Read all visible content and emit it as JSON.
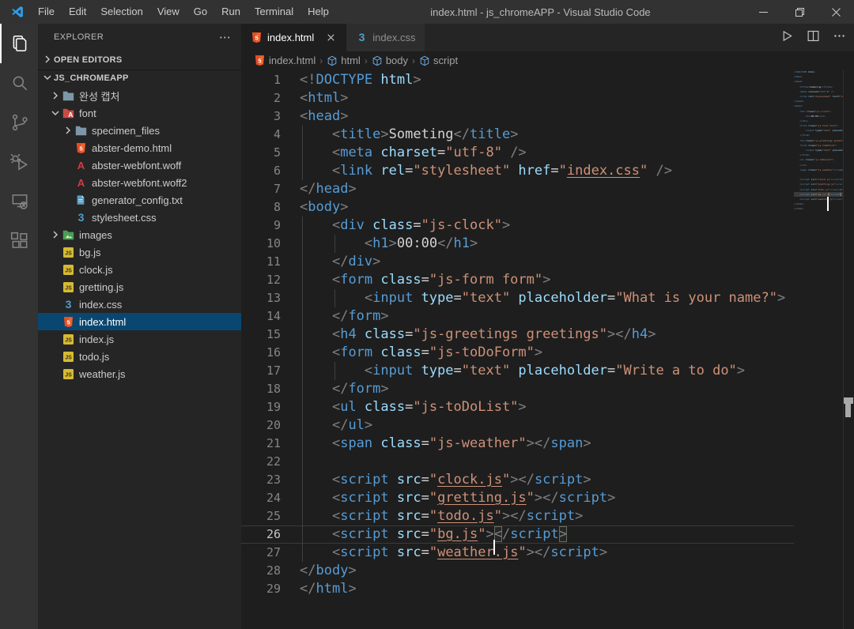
{
  "window": {
    "title": "index.html - js_chromeAPP - Visual Studio Code",
    "menus": [
      "File",
      "Edit",
      "Selection",
      "View",
      "Go",
      "Run",
      "Terminal",
      "Help"
    ],
    "controls": [
      "minimize",
      "restore",
      "close"
    ]
  },
  "activity_bar": {
    "items": [
      "explorer",
      "search",
      "source-control",
      "run-and-debug",
      "remote-explorer",
      "extensions"
    ],
    "active": "explorer"
  },
  "sidebar": {
    "header": "EXPLORER",
    "header_more": "⋯",
    "open_editors_label": "OPEN EDITORS",
    "root_label": "JS_CHROMEAPP",
    "tree": [
      {
        "label": "완성 캡처",
        "icon": "folder",
        "depth": 1,
        "chevron": "right"
      },
      {
        "label": "font",
        "icon": "folder-font",
        "depth": 1,
        "chevron": "down"
      },
      {
        "label": "specimen_files",
        "icon": "folder",
        "depth": 2,
        "chevron": "right"
      },
      {
        "label": "abster-demo.html",
        "icon": "html",
        "depth": 2
      },
      {
        "label": "abster-webfont.woff",
        "icon": "font-a",
        "depth": 2
      },
      {
        "label": "abster-webfont.woff2",
        "icon": "font-a",
        "depth": 2
      },
      {
        "label": "generator_config.txt",
        "icon": "txt",
        "depth": 2
      },
      {
        "label": "stylesheet.css",
        "icon": "css",
        "depth": 2
      },
      {
        "label": "images",
        "icon": "folder-images",
        "depth": 1,
        "chevron": "right"
      },
      {
        "label": "bg.js",
        "icon": "js",
        "depth": 1
      },
      {
        "label": "clock.js",
        "icon": "js",
        "depth": 1
      },
      {
        "label": "gretting.js",
        "icon": "js",
        "depth": 1
      },
      {
        "label": "index.css",
        "icon": "css",
        "depth": 1
      },
      {
        "label": "index.html",
        "icon": "html",
        "depth": 1,
        "selected": true
      },
      {
        "label": "index.js",
        "icon": "js",
        "depth": 1
      },
      {
        "label": "todo.js",
        "icon": "js",
        "depth": 1
      },
      {
        "label": "weather.js",
        "icon": "js",
        "depth": 1
      }
    ]
  },
  "tabs": [
    {
      "label": "index.html",
      "icon": "html",
      "active": true,
      "closable": true
    },
    {
      "label": "index.css",
      "icon": "css",
      "active": false,
      "closable": false
    }
  ],
  "editor_actions": [
    "run",
    "split-editor",
    "more-actions"
  ],
  "breadcrumb": [
    {
      "label": "index.html",
      "icon": "html"
    },
    {
      "label": "html",
      "icon": "cube"
    },
    {
      "label": "body",
      "icon": "cube"
    },
    {
      "label": "script",
      "icon": "cube"
    }
  ],
  "editor": {
    "current_line": 26,
    "lines": [
      [
        [
          "p",
          "<!"
        ],
        [
          "t",
          "DOCTYPE"
        ],
        [
          "a",
          " html"
        ],
        [
          "p",
          ">"
        ]
      ],
      [
        [
          "p",
          "<"
        ],
        [
          "t",
          "html"
        ],
        [
          "p",
          ">"
        ]
      ],
      [
        [
          "p",
          "<"
        ],
        [
          "t",
          "head"
        ],
        [
          "p",
          ">"
        ]
      ],
      [
        [
          "w",
          "    "
        ],
        [
          "p",
          "<"
        ],
        [
          "t",
          "title"
        ],
        [
          "p",
          ">"
        ],
        [
          "x",
          "Someting"
        ],
        [
          "p",
          "</"
        ],
        [
          "t",
          "title"
        ],
        [
          "p",
          ">"
        ]
      ],
      [
        [
          "w",
          "    "
        ],
        [
          "p",
          "<"
        ],
        [
          "t",
          "meta"
        ],
        [
          "a",
          " charset"
        ],
        [
          "o",
          "="
        ],
        [
          "s",
          "\"utf-8\""
        ],
        [
          "p",
          " />"
        ]
      ],
      [
        [
          "w",
          "    "
        ],
        [
          "p",
          "<"
        ],
        [
          "t",
          "link"
        ],
        [
          "a",
          " rel"
        ],
        [
          "o",
          "="
        ],
        [
          "s",
          "\"stylesheet\""
        ],
        [
          "a",
          " href"
        ],
        [
          "o",
          "="
        ],
        [
          "s",
          "\""
        ],
        [
          "u",
          "index.css"
        ],
        [
          "s",
          "\""
        ],
        [
          "p",
          " />"
        ]
      ],
      [
        [
          "p",
          "</"
        ],
        [
          "t",
          "head"
        ],
        [
          "p",
          ">"
        ]
      ],
      [
        [
          "p",
          "<"
        ],
        [
          "t",
          "body"
        ],
        [
          "p",
          ">"
        ]
      ],
      [
        [
          "w",
          "    "
        ],
        [
          "p",
          "<"
        ],
        [
          "t",
          "div"
        ],
        [
          "a",
          " class"
        ],
        [
          "o",
          "="
        ],
        [
          "s",
          "\"js-clock\""
        ],
        [
          "p",
          ">"
        ]
      ],
      [
        [
          "w",
          "        "
        ],
        [
          "p",
          "<"
        ],
        [
          "t",
          "h1"
        ],
        [
          "p",
          ">"
        ],
        [
          "x",
          "00:00"
        ],
        [
          "p",
          "</"
        ],
        [
          "t",
          "h1"
        ],
        [
          "p",
          ">"
        ]
      ],
      [
        [
          "w",
          "    "
        ],
        [
          "p",
          "</"
        ],
        [
          "t",
          "div"
        ],
        [
          "p",
          ">"
        ]
      ],
      [
        [
          "w",
          "    "
        ],
        [
          "p",
          "<"
        ],
        [
          "t",
          "form"
        ],
        [
          "a",
          " class"
        ],
        [
          "o",
          "="
        ],
        [
          "s",
          "\"js-form form\""
        ],
        [
          "p",
          ">"
        ]
      ],
      [
        [
          "w",
          "        "
        ],
        [
          "p",
          "<"
        ],
        [
          "t",
          "input"
        ],
        [
          "a",
          " type"
        ],
        [
          "o",
          "="
        ],
        [
          "s",
          "\"text\""
        ],
        [
          "a",
          " placeholder"
        ],
        [
          "o",
          "="
        ],
        [
          "s",
          "\"What is your name?\""
        ],
        [
          "p",
          ">"
        ]
      ],
      [
        [
          "w",
          "    "
        ],
        [
          "p",
          "</"
        ],
        [
          "t",
          "form"
        ],
        [
          "p",
          ">"
        ]
      ],
      [
        [
          "w",
          "    "
        ],
        [
          "p",
          "<"
        ],
        [
          "t",
          "h4"
        ],
        [
          "a",
          " class"
        ],
        [
          "o",
          "="
        ],
        [
          "s",
          "\"js-greetings greetings\""
        ],
        [
          "p",
          "></"
        ],
        [
          "t",
          "h4"
        ],
        [
          "p",
          ">"
        ]
      ],
      [
        [
          "w",
          "    "
        ],
        [
          "p",
          "<"
        ],
        [
          "t",
          "form"
        ],
        [
          "a",
          " class"
        ],
        [
          "o",
          "="
        ],
        [
          "s",
          "\"js-toDoForm\""
        ],
        [
          "p",
          ">"
        ]
      ],
      [
        [
          "w",
          "        "
        ],
        [
          "p",
          "<"
        ],
        [
          "t",
          "input"
        ],
        [
          "a",
          " type"
        ],
        [
          "o",
          "="
        ],
        [
          "s",
          "\"text\""
        ],
        [
          "a",
          " placeholder"
        ],
        [
          "o",
          "="
        ],
        [
          "s",
          "\"Write a to do\""
        ],
        [
          "p",
          ">"
        ]
      ],
      [
        [
          "w",
          "    "
        ],
        [
          "p",
          "</"
        ],
        [
          "t",
          "form"
        ],
        [
          "p",
          ">"
        ]
      ],
      [
        [
          "w",
          "    "
        ],
        [
          "p",
          "<"
        ],
        [
          "t",
          "ul"
        ],
        [
          "a",
          " class"
        ],
        [
          "o",
          "="
        ],
        [
          "s",
          "\"js-toDoList\""
        ],
        [
          "p",
          ">"
        ]
      ],
      [
        [
          "w",
          "    "
        ],
        [
          "p",
          "</"
        ],
        [
          "t",
          "ul"
        ],
        [
          "p",
          ">"
        ]
      ],
      [
        [
          "w",
          "    "
        ],
        [
          "p",
          "<"
        ],
        [
          "t",
          "span"
        ],
        [
          "a",
          " class"
        ],
        [
          "o",
          "="
        ],
        [
          "s",
          "\"js-weather\""
        ],
        [
          "p",
          "></"
        ],
        [
          "t",
          "span"
        ],
        [
          "p",
          ">"
        ]
      ],
      [],
      [
        [
          "w",
          "    "
        ],
        [
          "p",
          "<"
        ],
        [
          "t",
          "script"
        ],
        [
          "a",
          " src"
        ],
        [
          "o",
          "="
        ],
        [
          "s",
          "\""
        ],
        [
          "u",
          "clock.js"
        ],
        [
          "s",
          "\""
        ],
        [
          "p",
          "></"
        ],
        [
          "t",
          "script"
        ],
        [
          "p",
          ">"
        ]
      ],
      [
        [
          "w",
          "    "
        ],
        [
          "p",
          "<"
        ],
        [
          "t",
          "script"
        ],
        [
          "a",
          " src"
        ],
        [
          "o",
          "="
        ],
        [
          "s",
          "\""
        ],
        [
          "u",
          "gretting.js"
        ],
        [
          "s",
          "\""
        ],
        [
          "p",
          "></"
        ],
        [
          "t",
          "script"
        ],
        [
          "p",
          ">"
        ]
      ],
      [
        [
          "w",
          "    "
        ],
        [
          "p",
          "<"
        ],
        [
          "t",
          "script"
        ],
        [
          "a",
          " src"
        ],
        [
          "o",
          "="
        ],
        [
          "s",
          "\""
        ],
        [
          "u",
          "todo.js"
        ],
        [
          "s",
          "\""
        ],
        [
          "p",
          "></"
        ],
        [
          "t",
          "script"
        ],
        [
          "p",
          ">"
        ]
      ],
      [
        [
          "w",
          "    "
        ],
        [
          "p",
          "<"
        ],
        [
          "t",
          "script"
        ],
        [
          "a",
          " src"
        ],
        [
          "o",
          "="
        ],
        [
          "s",
          "\""
        ],
        [
          "u",
          "bg.js"
        ],
        [
          "s",
          "\""
        ],
        [
          "p",
          ">"
        ],
        [
          "cur",
          ""
        ],
        [
          "pb",
          "<"
        ],
        [
          "p",
          "/"
        ],
        [
          "t",
          "script"
        ],
        [
          "pb",
          ">"
        ]
      ],
      [
        [
          "w",
          "    "
        ],
        [
          "p",
          "<"
        ],
        [
          "t",
          "script"
        ],
        [
          "a",
          " src"
        ],
        [
          "o",
          "="
        ],
        [
          "s",
          "\""
        ],
        [
          "u",
          "weather.js"
        ],
        [
          "s",
          "\""
        ],
        [
          "p",
          "></"
        ],
        [
          "t",
          "script"
        ],
        [
          "p",
          ">"
        ]
      ],
      [
        [
          "p",
          "</"
        ],
        [
          "t",
          "body"
        ],
        [
          "p",
          ">"
        ]
      ],
      [
        [
          "p",
          "</"
        ],
        [
          "t",
          "html"
        ],
        [
          "p",
          ">"
        ]
      ]
    ]
  },
  "colors": {
    "editor_bg": "#1e1e1e",
    "sidebar_bg": "#252526",
    "activitybar_bg": "#333333",
    "titlebar_bg": "#323233",
    "selection_bg": "#094771",
    "tag": "#569cd6",
    "attribute": "#9cdcfe",
    "string": "#ce9178",
    "punctuation": "#808080",
    "html_icon": "#e44d26",
    "css_icon": "#4d9fcb",
    "js_icon": "#d6ba32",
    "font_icon": "#cc3e44",
    "folder_icon": "#7d97a8",
    "images_folder": "#4c9e54"
  }
}
